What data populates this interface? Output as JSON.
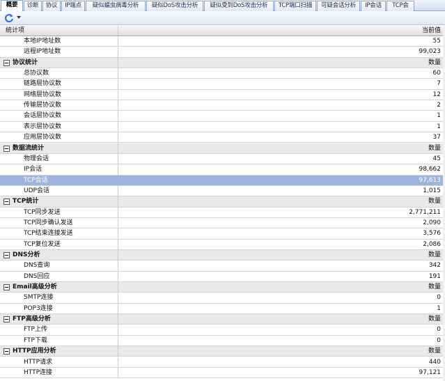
{
  "tabs": [
    {
      "label": "概要",
      "active": true
    },
    {
      "label": "诊断"
    },
    {
      "label": "协议"
    },
    {
      "label": "IP端点"
    },
    {
      "label": "疑似蠕虫病毒分析"
    },
    {
      "label": "疑似DoS攻击分析"
    },
    {
      "label": "疑似受到DoS攻击分析"
    },
    {
      "label": "TCP端口扫描"
    },
    {
      "label": "可疑会话分析"
    },
    {
      "label": "IP会话"
    },
    {
      "label": "TCP会"
    }
  ],
  "toolbar": {
    "refresh_icon": "refresh-icon",
    "dropdown_icon": "chevron-down-icon"
  },
  "grid": {
    "header": {
      "name": "统计项",
      "value": "当前值"
    },
    "rows": [
      {
        "kind": "item",
        "label": "本地IP地址数",
        "value": "55"
      },
      {
        "kind": "item",
        "label": "远程IP地址数",
        "value": "99,023"
      },
      {
        "kind": "group",
        "label": "协议统计",
        "value": "数量"
      },
      {
        "kind": "item",
        "label": "总协议数",
        "value": "60"
      },
      {
        "kind": "item",
        "label": "链路层协议数",
        "value": "7"
      },
      {
        "kind": "item",
        "label": "网络层协议数",
        "value": "12"
      },
      {
        "kind": "item",
        "label": "传输层协议数",
        "value": "2"
      },
      {
        "kind": "item",
        "label": "会话层协议数",
        "value": "1"
      },
      {
        "kind": "item",
        "label": "表示层协议数",
        "value": "1"
      },
      {
        "kind": "item",
        "label": "应用层协议数",
        "value": "37"
      },
      {
        "kind": "group",
        "label": "数据流统计",
        "value": "数量"
      },
      {
        "kind": "item",
        "label": "物理会话",
        "value": "45"
      },
      {
        "kind": "item",
        "label": "IP会话",
        "value": "98,662"
      },
      {
        "kind": "item",
        "label": "TCP会话",
        "value": "97,613",
        "selected": true
      },
      {
        "kind": "item",
        "label": "UDP会话",
        "value": "1,015"
      },
      {
        "kind": "group",
        "label": "TCP统计",
        "value": "数量"
      },
      {
        "kind": "item",
        "label": "TCP同步发送",
        "value": "2,771,211"
      },
      {
        "kind": "item",
        "label": "TCP同步确认发送",
        "value": "2,090"
      },
      {
        "kind": "item",
        "label": "TCP结束连接发送",
        "value": "3,576"
      },
      {
        "kind": "item",
        "label": "TCP复位发送",
        "value": "2,086"
      },
      {
        "kind": "group",
        "label": "DNS分析",
        "value": "数量"
      },
      {
        "kind": "item",
        "label": "DNS查询",
        "value": "342"
      },
      {
        "kind": "item",
        "label": "DNS回应",
        "value": "191"
      },
      {
        "kind": "group",
        "label": "Email高级分析",
        "value": "数量"
      },
      {
        "kind": "item",
        "label": "SMTP连接",
        "value": "0"
      },
      {
        "kind": "item",
        "label": "POP3连接",
        "value": "1"
      },
      {
        "kind": "group",
        "label": "FTP高级分析",
        "value": "数量"
      },
      {
        "kind": "item",
        "label": "FTP上传",
        "value": "0"
      },
      {
        "kind": "item",
        "label": "FTP下载",
        "value": "0"
      },
      {
        "kind": "group",
        "label": "HTTP应用分析",
        "value": "数量"
      },
      {
        "kind": "item",
        "label": "HTTP请求",
        "value": "440"
      },
      {
        "kind": "item",
        "label": "HTTP连接",
        "value": "97,121"
      }
    ]
  }
}
